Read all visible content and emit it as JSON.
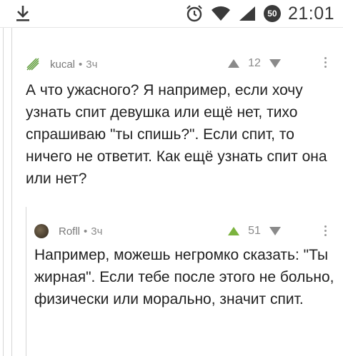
{
  "status_bar": {
    "time": "21:01",
    "battery": "50",
    "icons": [
      "download-icon",
      "alarm-icon",
      "wifi-icon",
      "signal-icon",
      "battery-icon"
    ]
  },
  "comments": [
    {
      "author": "kucal",
      "separator": "•",
      "time": "3ч",
      "votes": "12",
      "avatar_icon": "leaf-avatar-icon",
      "text": "А что ужасного? Я например, если хочу узнать спит девушка или ещё нет, тихо спрашиваю \"ты спишь?\". Если спит, то ничего не ответит. Как ещё узнать спит она или нет?"
    },
    {
      "author": "Rofll",
      "separator": "•",
      "time": "3ч",
      "votes": "51",
      "avatar_icon": "user-avatar",
      "text": "Например, можешь негромко сказать: \"Ты жирная\". Если тебе после этого не больно, физически или морально, значит спит."
    }
  ],
  "colors": {
    "upvote_active": "#7bb33e",
    "icon_gray": "#8a8a8a",
    "thread_line": "#d6d6d6"
  }
}
